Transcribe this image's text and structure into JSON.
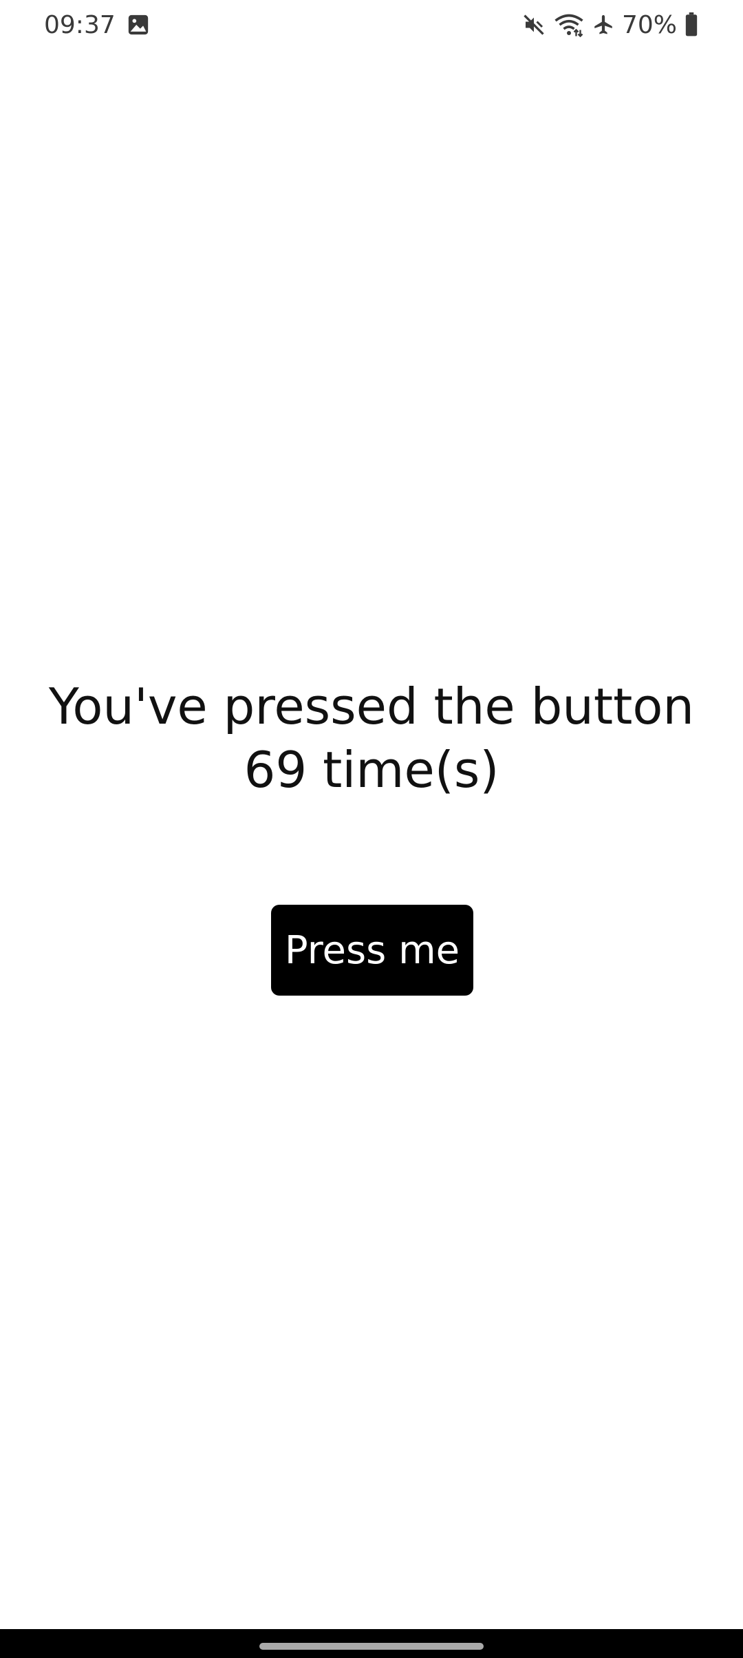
{
  "status_bar": {
    "time": "09:37",
    "battery_percent": "70%",
    "icons": [
      "gallery-icon",
      "mute-icon",
      "wifi-icon",
      "airplane-icon",
      "battery-icon"
    ],
    "battery_level": 0.7
  },
  "main": {
    "counter_text": "You've pressed the button 69 time(s)",
    "button_label": "Press me"
  },
  "colors": {
    "background": "#ffffff",
    "button_background": "#000000",
    "button_text": "#ffffff",
    "nav_bar": "#000000"
  }
}
